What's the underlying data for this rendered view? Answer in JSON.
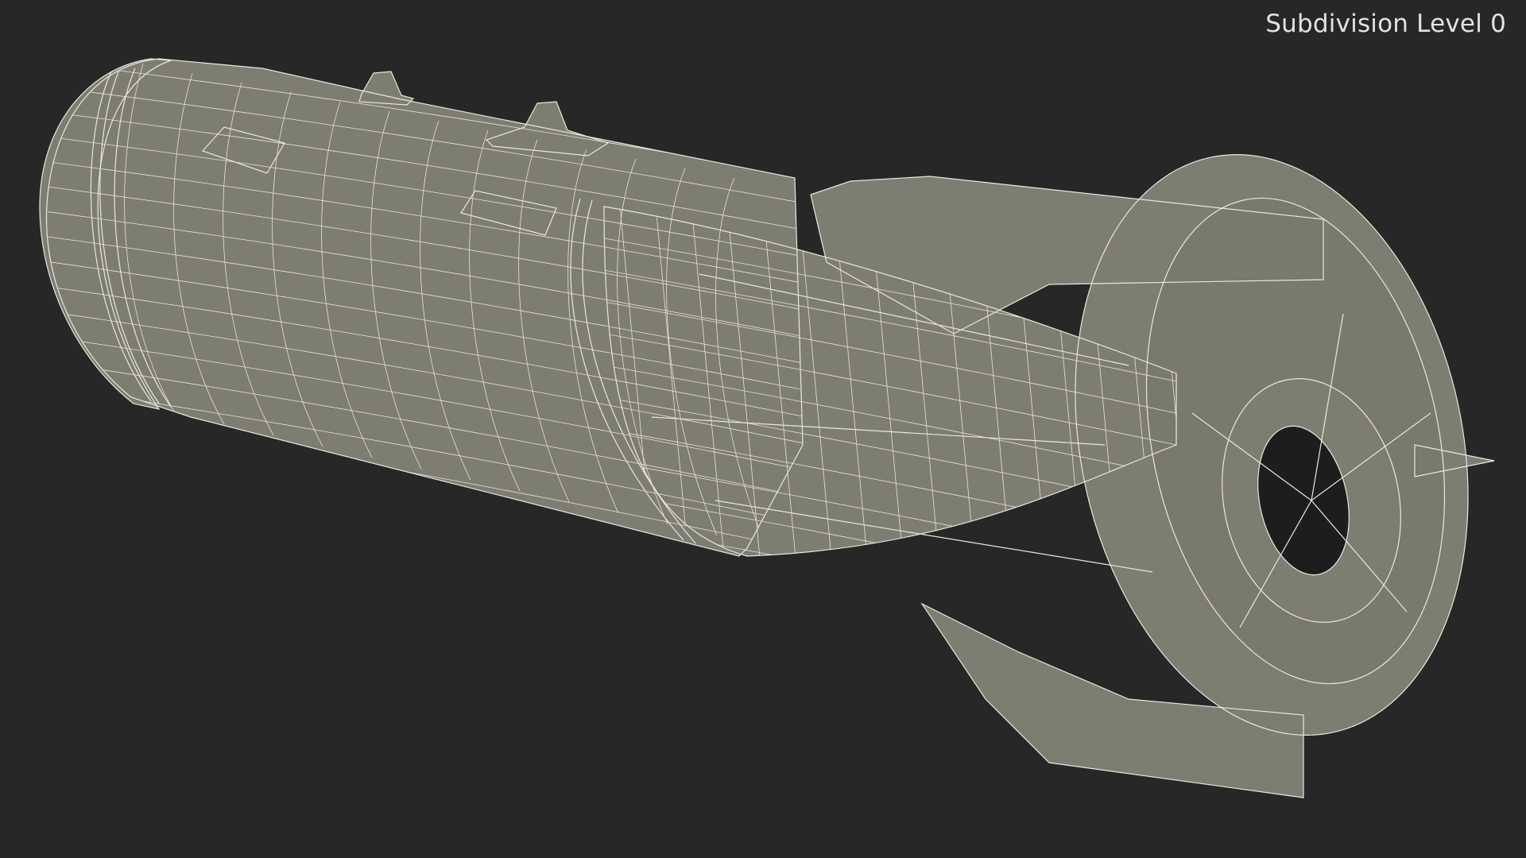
{
  "viewport": {
    "subdivision_label": "Subdivision Level 0",
    "background_color": "#272727",
    "model_fill_color": "#7e7d72",
    "wire_color": "#e9e8dd",
    "model_subject": "bomb-wireframe-model"
  }
}
